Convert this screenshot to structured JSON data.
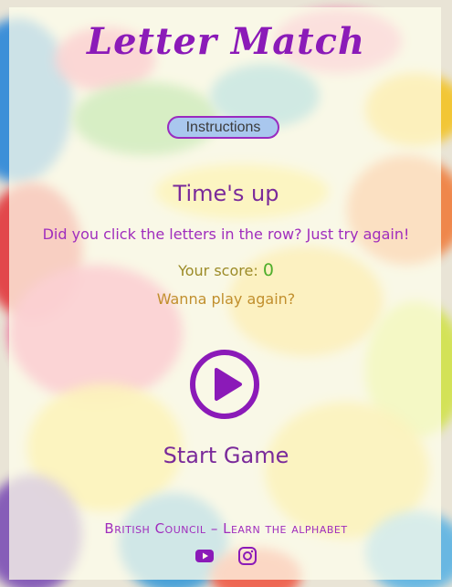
{
  "game": {
    "title": "Letter Match",
    "instructions_label": "Instructions",
    "status_title": "Time's up",
    "hint_text": "Did you click the letters in the row? Just try again!",
    "score_label": "Your score:",
    "score_value": "0",
    "play_again_text": "Wanna play again?",
    "start_label": "Start Game"
  },
  "footer": {
    "credit": "British Council – Learn the alphabet",
    "social": [
      "youtube-icon",
      "instagram-icon"
    ]
  },
  "colors": {
    "accent": "#8b1ab8",
    "button_fill": "#a9c7ee",
    "score_value": "#4fae2b"
  }
}
